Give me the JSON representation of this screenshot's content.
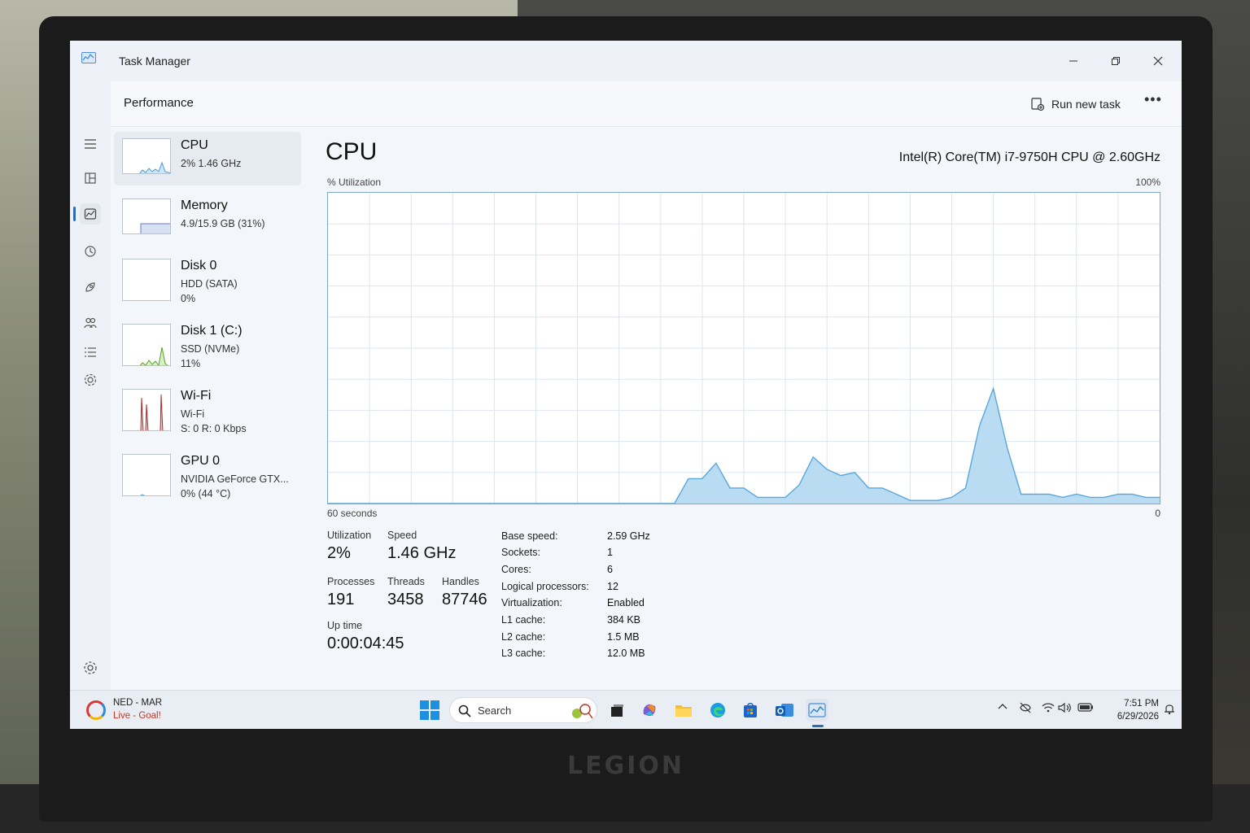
{
  "window": {
    "title": "Task Manager"
  },
  "header": {
    "page_title": "Performance",
    "run_task_label": "Run new task"
  },
  "devices": [
    {
      "name": "CPU",
      "line1": "2% 1.46 GHz",
      "line2": ""
    },
    {
      "name": "Memory",
      "line1": "4.9/15.9 GB (31%)",
      "line2": ""
    },
    {
      "name": "Disk 0",
      "line1": "HDD (SATA)",
      "line2": "0%"
    },
    {
      "name": "Disk 1 (C:)",
      "line1": "SSD (NVMe)",
      "line2": "11%"
    },
    {
      "name": "Wi-Fi",
      "line1": "Wi-Fi",
      "line2": "S: 0 R: 0 Kbps"
    },
    {
      "name": "GPU 0",
      "line1": "NVIDIA GeForce GTX...",
      "line2": "0% (44 °C)"
    }
  ],
  "main": {
    "title": "CPU",
    "model": "Intel(R) Core(TM) i7-9750H CPU @ 2.60GHz",
    "y_label": "% Utilization",
    "y_max_label": "100%",
    "x_left_label": "60 seconds",
    "x_right_label": "0"
  },
  "stats": {
    "utilization_label": "Utilization",
    "utilization": "2%",
    "speed_label": "Speed",
    "speed": "1.46 GHz",
    "processes_label": "Processes",
    "processes": "191",
    "threads_label": "Threads",
    "threads": "3458",
    "handles_label": "Handles",
    "handles": "87746",
    "uptime_label": "Up time",
    "uptime": "0:00:04:45"
  },
  "specs": [
    {
      "label": "Base speed:",
      "value": "2.59 GHz"
    },
    {
      "label": "Sockets:",
      "value": "1"
    },
    {
      "label": "Cores:",
      "value": "6"
    },
    {
      "label": "Logical processors:",
      "value": "12"
    },
    {
      "label": "Virtualization:",
      "value": "Enabled"
    },
    {
      "label": "L1 cache:",
      "value": "384 KB"
    },
    {
      "label": "L2 cache:",
      "value": "1.5 MB"
    },
    {
      "label": "L3 cache:",
      "value": "12.0 MB"
    }
  ],
  "chart_data": {
    "type": "area",
    "title": "CPU",
    "ylabel": "% Utilization",
    "xlabel": "60 seconds",
    "ylim": [
      0,
      100
    ],
    "xlim": [
      60,
      0
    ],
    "x": [
      60,
      58,
      56,
      54,
      52,
      50,
      48,
      46,
      44,
      42,
      40,
      38,
      36,
      35,
      34,
      33,
      32,
      31,
      30,
      29,
      28,
      27,
      26,
      25,
      24,
      23,
      22,
      21,
      20,
      19,
      18,
      17,
      16,
      15,
      14,
      13,
      12,
      11,
      10,
      9,
      8,
      7,
      6,
      5,
      4,
      3,
      2,
      1,
      0
    ],
    "values": [
      0,
      0,
      0,
      0,
      0,
      0,
      0,
      0,
      0,
      0,
      0,
      0,
      0,
      0,
      8,
      8,
      13,
      5,
      5,
      2,
      2,
      2,
      6,
      15,
      11,
      9,
      10,
      5,
      5,
      3,
      1,
      1,
      1,
      2,
      5,
      25,
      37,
      18,
      3,
      3,
      3,
      2,
      3,
      2,
      2,
      3,
      3,
      2,
      2
    ],
    "grid": true,
    "line_color": "#5aa7dc",
    "fill_color": "#b9dcf2"
  },
  "taskbar": {
    "widget_title": "NED - MAR",
    "widget_sub": "Live - Goal!",
    "search_label": "Search",
    "time": "7:51 PM",
    "date": "6/29/2026"
  },
  "branding": {
    "laptop": "LEGION"
  },
  "icons": [
    "hamburger-icon",
    "processes-icon",
    "performance-icon",
    "history-icon",
    "startup-icon",
    "users-icon",
    "details-icon",
    "services-icon",
    "settings-icon",
    "run-task-icon",
    "more-icon",
    "start-icon",
    "search-icon"
  ]
}
